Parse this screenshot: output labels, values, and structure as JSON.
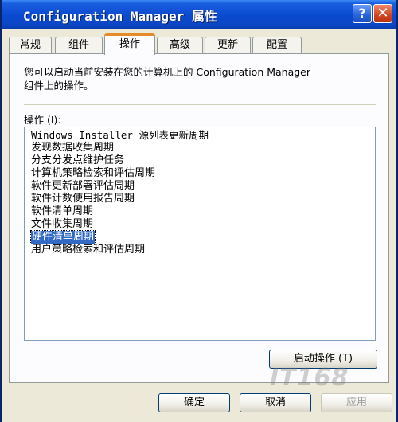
{
  "window": {
    "title": "Configuration Manager 属性",
    "help_glyph": "?",
    "close_glyph": "✕"
  },
  "tabs": [
    {
      "label": "常规",
      "active": false
    },
    {
      "label": "组件",
      "active": false
    },
    {
      "label": "操作",
      "active": true
    },
    {
      "label": "高级",
      "active": false
    },
    {
      "label": "更新",
      "active": false
    },
    {
      "label": "配置",
      "active": false
    }
  ],
  "panel": {
    "description_line1": "您可以启动当前安装在您的计算机上的 Configuration Manager",
    "description_line2": "组件上的操作。",
    "list_label": "操作 (I):",
    "actions": [
      "Windows Installer 源列表更新周期",
      "发现数据收集周期",
      "分支分发点维护任务",
      "计算机策略检索和评估周期",
      "软件更新部署评估周期",
      "软件计数使用报告周期",
      "软件清单周期",
      "文件收集周期",
      "硬件清单周期",
      "用户策略检索和评估周期"
    ],
    "selected_action": "硬件清单周期",
    "run_button": "启动操作 (T)"
  },
  "footer": {
    "ok_button": "确定",
    "cancel_button": "取消",
    "apply_button": "应用"
  },
  "watermark": "IT168"
}
